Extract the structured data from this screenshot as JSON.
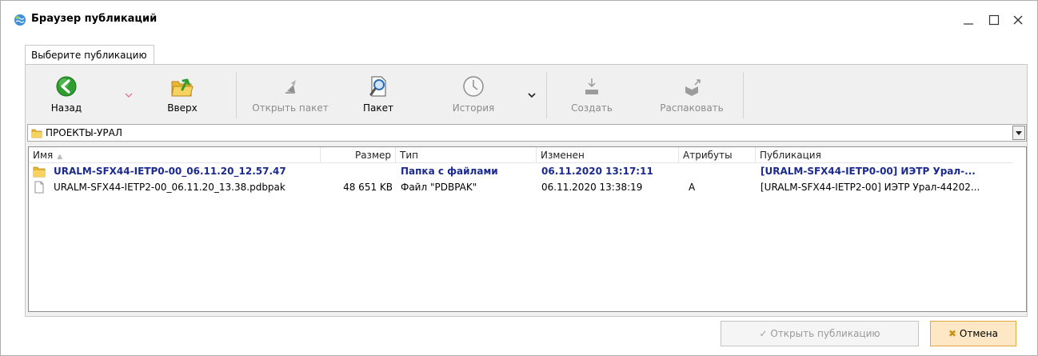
{
  "window": {
    "title": "Браузер публикаций"
  },
  "tab": {
    "label": "Выберите публикацию"
  },
  "toolbar": {
    "back": "Назад",
    "up": "Вверх",
    "open_package": "Открыть пакет",
    "package": "Пакет",
    "history": "История",
    "create": "Создать",
    "unpack": "Распаковать"
  },
  "path": {
    "value": "ПРОЕКТЫ-УРАЛ"
  },
  "columns": {
    "name": "Имя",
    "size": "Размер",
    "type": "Тип",
    "modified": "Изменен",
    "attributes": "Атрибуты",
    "publication": "Публикация"
  },
  "rows": [
    {
      "name": "URALM-SFX44-IETP0-00_06.11.20_12.57.47",
      "size": "",
      "type": "Папка с файлами",
      "modified": "06.11.2020 13:17:11",
      "attributes": "",
      "publication": "[URALM-SFX44-IETP0-00] ИЭТР Урал-..."
    },
    {
      "name": "URALM-SFX44-IETP2-00_06.11.20_13.38.pdbpak",
      "size": "48 651 KB",
      "type": "Файл \"PDBPAK\"",
      "modified": "06.11.2020 13:38:19",
      "attributes": "A",
      "publication": "[URALM-SFX44-IETP2-00] ИЭТР Урал-44202..."
    }
  ],
  "buttons": {
    "open_publication": "Открыть публикацию",
    "cancel": "Отмена"
  },
  "colors": {
    "accent_blue": "#1b2a8e",
    "folder_yellow": "#e8b830",
    "back_green": "#2f9e2f",
    "cancel_bg": "#fde7c4"
  }
}
